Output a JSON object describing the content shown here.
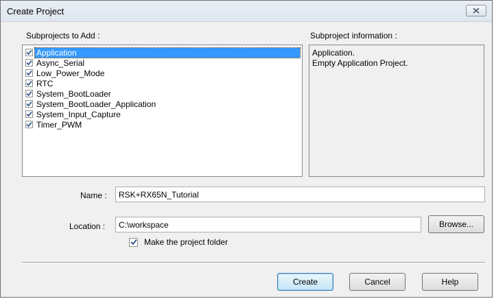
{
  "window": {
    "title": "Create Project"
  },
  "subprojects": {
    "heading": "Subprojects to Add :",
    "items": [
      {
        "label": "Application",
        "checked": true,
        "selected": true
      },
      {
        "label": "Async_Serial",
        "checked": true,
        "selected": false
      },
      {
        "label": "Low_Power_Mode",
        "checked": true,
        "selected": false
      },
      {
        "label": "RTC",
        "checked": true,
        "selected": false
      },
      {
        "label": "System_BootLoader",
        "checked": true,
        "selected": false
      },
      {
        "label": "System_BootLoader_Application",
        "checked": true,
        "selected": false
      },
      {
        "label": "System_Input_Capture",
        "checked": true,
        "selected": false
      },
      {
        "label": "Timer_PWM",
        "checked": true,
        "selected": false
      }
    ]
  },
  "info": {
    "heading": "Subproject information :",
    "lines": [
      "Application.",
      "Empty Application Project."
    ]
  },
  "form": {
    "name_label": "Name :",
    "name_value": "RSK+RX65N_Tutorial",
    "location_label": "Location :",
    "location_value": "C:\\workspace",
    "browse_label": "Browse...",
    "make_folder_label": "Make the project folder",
    "make_folder_checked": true
  },
  "buttons": {
    "create": "Create",
    "cancel": "Cancel",
    "help": "Help"
  },
  "icons": {
    "close": "close-icon",
    "check": "check-icon"
  },
  "colors": {
    "selection": "#3399ff",
    "dialog_bg": "#f0f0f0",
    "check": "#3a5b8c"
  }
}
